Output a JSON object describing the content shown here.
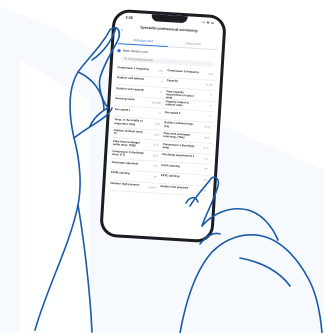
{
  "colors": {
    "accent": "#2a6fe0",
    "hand_outline": "#1a5ba8",
    "bg_shape": "#eef4fb"
  },
  "status": {
    "time": "3:36",
    "icons": "▪▪ ≋ ▭"
  },
  "header": {
    "back_icon": "chevron-left-icon",
    "title": "Specialist professional monitoring"
  },
  "tabs": [
    {
      "label": "Indicator card"
    },
    {
      "label": "Indoor unit"
    }
  ],
  "section": {
    "title": "Basic Outdoor unit",
    "chevron": "⌄"
  },
  "unit_id": "ID: 1710123456001-0001",
  "parameters": [
    [
      {
        "label": "Compressor 1 frequency",
        "value": "0 Hz"
      },
      {
        "label": "Compressor 2 frequency",
        "value": "0 Hz"
      }
    ],
    [
      {
        "label": "Outdoor unit address",
        "value": "0"
      },
      {
        "label": "Capacity",
        "value": "14 kW"
      }
    ],
    [
      {
        "label": "Outdoor unit capacity",
        "value": "0"
      },
      {
        "label": "Total capacity requirement of indoor units",
        "value": "0"
      }
    ],
    [
      {
        "label": "Running mode",
        "value": "Standby"
      },
      {
        "label": "Capacity output to outdoor units",
        "value": "0"
      }
    ],
    [
      {
        "label": "Fan speed 1",
        "value": "0"
      },
      {
        "label": "Fan speed 2",
        "value": "0"
      }
    ],
    [
      {
        "label": "Temp. in the middle of evaporator (Tp4)",
        "value": "15°C"
      },
      {
        "label": "Outdoor ambient temp. (T4)",
        "value": "15°C"
      }
    ],
    [
      {
        "label": "Outdoor ambient temp. T3",
        "value": "16°C"
      },
      {
        "label": "Plate heat exchanger inlet temp. (T6A)",
        "value": "16°C"
      }
    ],
    [
      {
        "label": "Plate heat exchanger outlet temp. (T6B)",
        "value": "16°C"
      },
      {
        "label": "Compressor 1 discharge temp.",
        "value": "20°C"
      }
    ],
    [
      {
        "label": "Compressor 2 discharge temp. (T7)",
        "value": "18°C"
      },
      {
        "label": "Discharge superheat of 1",
        "value": "0°C"
      }
    ],
    [
      {
        "label": "Discharge superheat",
        "value": "0°C"
      },
      {
        "label": "EXVA opening",
        "value": "0P"
      }
    ],
    [
      {
        "label": "EXVB opening",
        "value": "0P"
      },
      {
        "label": "EXVC opening",
        "value": "0P"
      }
    ],
    [
      {
        "label": "Outdoor high pressure",
        "value": "1.2MPa"
      },
      {
        "label": "Outdoor low pressure",
        "value": "1.1MPa"
      }
    ]
  ]
}
